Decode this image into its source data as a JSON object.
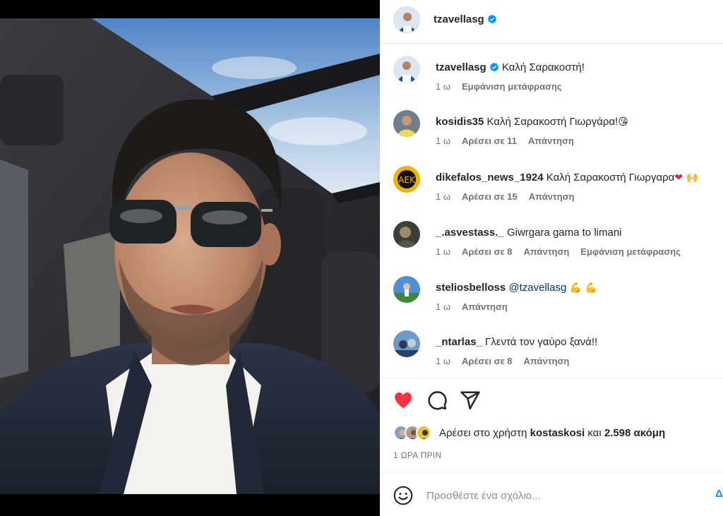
{
  "post": {
    "author": "tzavellasg",
    "caption": "Καλή Σαρακοστή!",
    "caption_time": "1 ω",
    "see_translation": "Εμφάνιση μετάφρασης",
    "liked": true,
    "likes_prefix": "Αρέσει στο χρήστη",
    "likes_user": "kostaskosi",
    "likes_and": "και",
    "likes_count": "2.598 ακόμη",
    "time_ago": "1 ΩΡΑ ΠΡΙΝ"
  },
  "comments": [
    {
      "username": "kosidis35",
      "text": "Καλή Σαρακοστή Γιωργάρα!",
      "emoji": "😘",
      "time": "1 ω",
      "likes": "Αρέσει σε 11",
      "reply": "Απάντηση"
    },
    {
      "username": "dikefalos_news_1924",
      "text": "Καλή Σαρακοστή Γιωργαρα",
      "emoji": "❤ 🙌",
      "time": "1 ω",
      "likes": "Αρέσει σε 15",
      "reply": "Απάντηση"
    },
    {
      "username": "_.asvestass._",
      "text": "Giwrgara gama to limani",
      "time": "1 ω",
      "likes": "Αρέσει σε 8",
      "reply": "Απάντηση",
      "see_translation": "Εμφάνιση μετάφρασης"
    },
    {
      "username": "steliosbelloss",
      "mention": "@tzavellasg",
      "emoji": "💪 💪",
      "time": "1 ω",
      "reply": "Απάντηση"
    },
    {
      "username": "_ntarlas_",
      "text": "Γλεντά τον γαύρο ξανά!!",
      "time": "1 ω",
      "likes": "Αρέσει σε 8",
      "reply": "Απάντηση"
    }
  ],
  "add_comment": {
    "placeholder": "Προσθέστε ένα σχόλιο...",
    "post_label": "Δ"
  },
  "icons": {
    "verified": "verified-badge-icon",
    "like": "heart-icon",
    "comment": "comment-icon",
    "share": "share-icon",
    "emoji": "smile-icon"
  },
  "colors": {
    "liked_heart": "#ff3040",
    "verified_badge": "#0095f6",
    "secondary_text": "#737373",
    "mention": "#00376b"
  }
}
